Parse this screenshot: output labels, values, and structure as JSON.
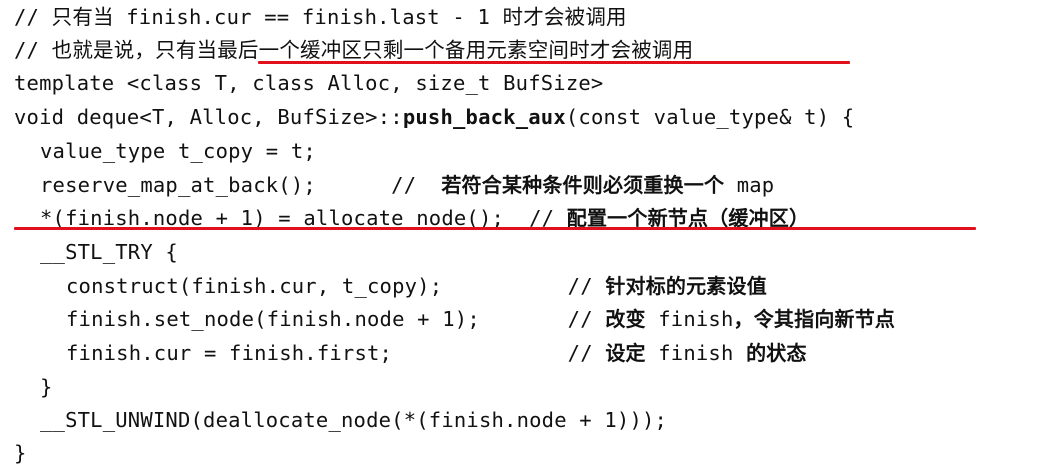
{
  "accent_color": "#e0101c",
  "lines": [
    {
      "id": "comment-1",
      "segments": [
        {
          "text": "// 只有当 finish.cur == finish.last - 1 时才会被调用",
          "style": "code"
        }
      ]
    },
    {
      "id": "comment-2",
      "segments": [
        {
          "text": "// 也就是说，只有当最后一个缓冲区只剩一个备用元素空间时才会被调用",
          "style": "code"
        }
      ]
    },
    {
      "id": "template-decl",
      "segments": [
        {
          "text": "template <class T, class Alloc, size_t BufSize>",
          "style": "code"
        }
      ]
    },
    {
      "id": "function-signature",
      "segments": [
        {
          "text": "void deque<T, Alloc, BufSize>::",
          "style": "code"
        },
        {
          "text": "push_back_aux",
          "style": "bold"
        },
        {
          "text": "(const value_type& t) {",
          "style": "code"
        }
      ]
    },
    {
      "id": "copy-stmt",
      "segments": [
        {
          "text": "value_type t_copy = t;",
          "style": "code"
        }
      ]
    },
    {
      "id": "reserve-stmt",
      "segments": [
        {
          "text": "reserve_map_at_back();      //  ",
          "style": "code"
        },
        {
          "text": "若符合某种条件则必须重换一个",
          "style": "cjk"
        },
        {
          "text": " map",
          "style": "code"
        }
      ]
    },
    {
      "id": "allocate-stmt",
      "segments": [
        {
          "text": "*(finish.node + 1) = allocate_node();  // ",
          "style": "code"
        },
        {
          "text": "配置一个新节点（缓冲区）",
          "style": "cjk"
        }
      ]
    },
    {
      "id": "try-open",
      "segments": [
        {
          "text": "__STL_TRY {",
          "style": "code"
        }
      ]
    },
    {
      "id": "construct-stmt",
      "segments": [
        {
          "text": "construct(finish.cur, t_copy);          // ",
          "style": "code"
        },
        {
          "text": "针对标的元素设值",
          "style": "cjk"
        }
      ]
    },
    {
      "id": "set-node-stmt",
      "segments": [
        {
          "text": "finish.set_node(finish.node + 1);       // ",
          "style": "code"
        },
        {
          "text": "改变",
          "style": "cjk"
        },
        {
          "text": " finish",
          "style": "code"
        },
        {
          "text": "，令其指向新节点",
          "style": "cjk"
        }
      ]
    },
    {
      "id": "cur-first-stmt",
      "segments": [
        {
          "text": "finish.cur = finish.first;              // ",
          "style": "code"
        },
        {
          "text": "设定",
          "style": "cjk"
        },
        {
          "text": " finish ",
          "style": "code"
        },
        {
          "text": "的状态",
          "style": "cjk"
        }
      ]
    },
    {
      "id": "try-close",
      "segments": [
        {
          "text": "}",
          "style": "code"
        }
      ]
    },
    {
      "id": "unwind-stmt",
      "segments": [
        {
          "text": "__STL_UNWIND(deallocate_node(*(finish.node + 1)));",
          "style": "code"
        }
      ]
    },
    {
      "id": "function-close",
      "segments": [
        {
          "text": "}",
          "style": "code"
        }
      ]
    }
  ]
}
